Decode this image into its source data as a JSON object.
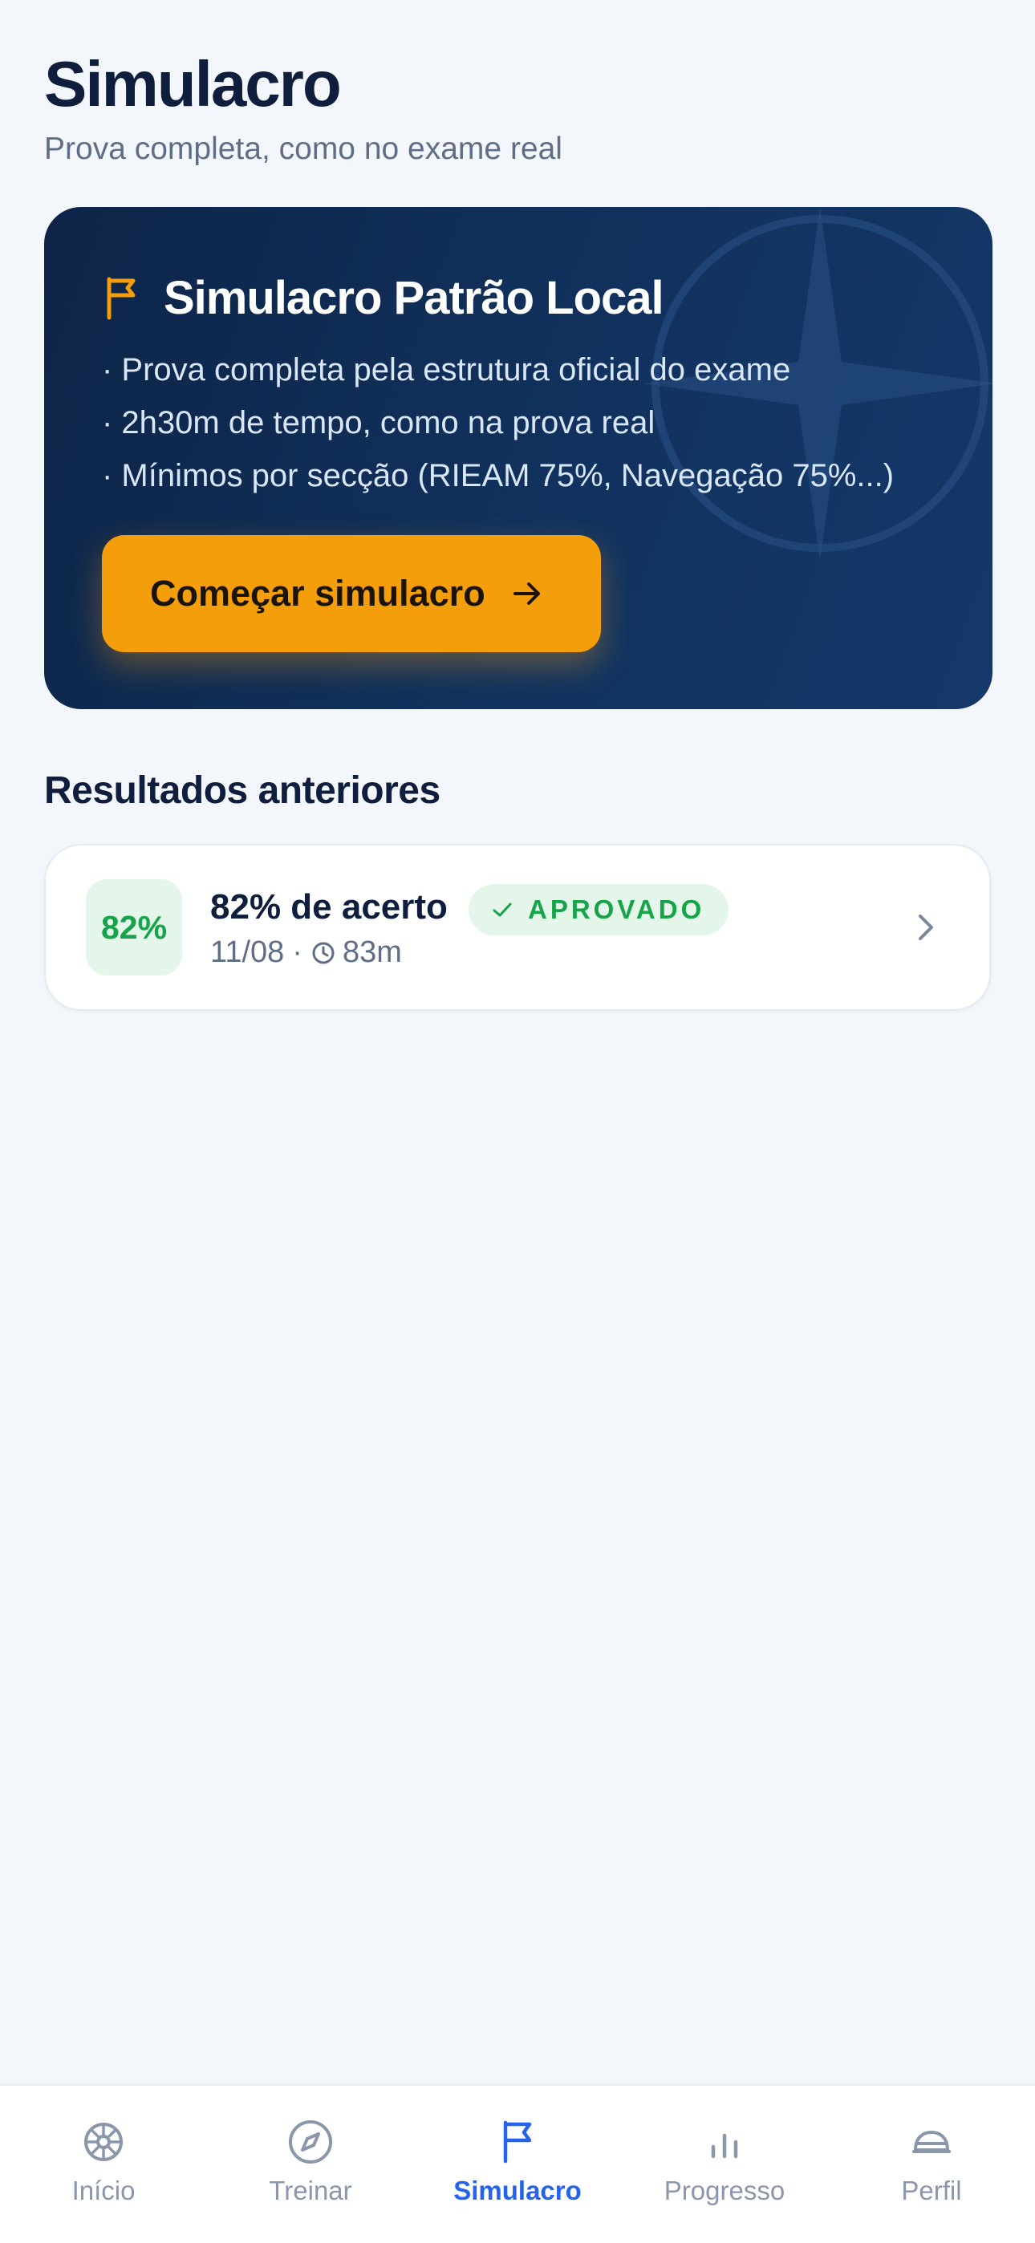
{
  "header": {
    "title": "Simulacro",
    "subtitle": "Prova completa, como no exame real"
  },
  "hero": {
    "icon": "flag-icon",
    "title": "Simulacro Patrão Local",
    "bullets": [
      "· Prova completa pela estrutura oficial do exame",
      "· 2h30m de tempo, como na prova real",
      "· Mínimos por secção (RIEAM 75%, Navegação 75%...)"
    ],
    "start_label": "Começar simulacro",
    "accent_color": "#F59E0B"
  },
  "results": {
    "section_title": "Resultados anteriores",
    "items": [
      {
        "score": "82%",
        "title": "82% de acerto",
        "status": "APROVADO",
        "date": "11/08",
        "separator": "·",
        "duration": "83m",
        "status_color": "#16A34A"
      }
    ]
  },
  "nav": {
    "active": "Simulacro",
    "active_color": "#2563EB",
    "items": [
      {
        "label": "Início",
        "icon": "helm-icon"
      },
      {
        "label": "Treinar",
        "icon": "compass-icon"
      },
      {
        "label": "Simulacro",
        "icon": "flag-icon"
      },
      {
        "label": "Progresso",
        "icon": "bar-chart-icon"
      },
      {
        "label": "Perfil",
        "icon": "captain-hat-icon"
      }
    ]
  }
}
